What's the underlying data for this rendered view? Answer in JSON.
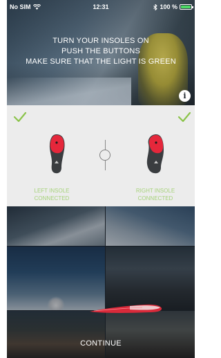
{
  "status_bar": {
    "carrier": "No SIM",
    "time": "12:31",
    "battery_percent": "100 %",
    "battery_level": 1.0,
    "wifi_icon": "wifi-icon",
    "bluetooth_icon": "bluetooth-icon"
  },
  "instructions": {
    "line1": "TURN YOUR INSOLES ON",
    "line2": "PUSH THE BUTTONS",
    "line3": "MAKE SURE THAT THE LIGHT IS GREEN"
  },
  "info_button": {
    "icon": "info-icon",
    "glyph": "i"
  },
  "insoles": {
    "left": {
      "label_line1": "LEFT INSOLE",
      "label_line2": "CONNECTED",
      "status_icon": "checkmark-icon"
    },
    "right": {
      "label_line1": "RIGHT INSOLE",
      "label_line2": "CONNECTED",
      "status_icon": "checkmark-icon"
    }
  },
  "continue_button": {
    "label": "CONTINUE"
  },
  "colors": {
    "connected_green": "#a6d27a",
    "check_green": "#8bc34a",
    "insole_red": "#e5273b",
    "panel_bg": "#ececec"
  }
}
